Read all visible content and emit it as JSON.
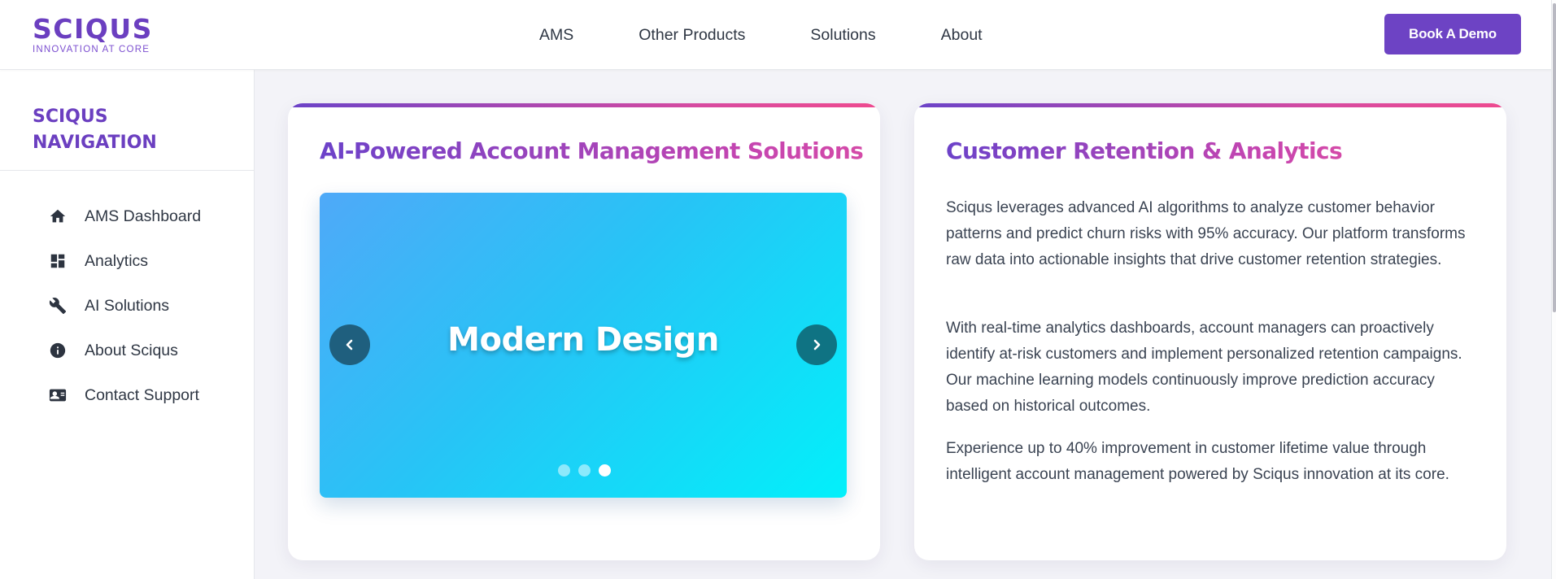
{
  "header": {
    "logo_title": "SCIQUS",
    "logo_tagline": "INNOVATION AT CORE",
    "nav": [
      "AMS",
      "Other Products",
      "Solutions",
      "About"
    ],
    "cta_label": "Book A Demo"
  },
  "sidebar": {
    "title_line1": "SCIQUS",
    "title_line2": "NAVIGATION",
    "items": [
      {
        "label": "AMS Dashboard",
        "icon": "home-icon"
      },
      {
        "label": "Analytics",
        "icon": "dashboard-icon"
      },
      {
        "label": "AI Solutions",
        "icon": "wrench-icon"
      },
      {
        "label": "About Sciqus",
        "icon": "info-icon"
      },
      {
        "label": "Contact Support",
        "icon": "contact-card-icon"
      }
    ]
  },
  "left_card": {
    "title": "AI-Powered Account Management Solutions",
    "carousel": {
      "slide_title": "Modern Design",
      "slide_count": 3,
      "active_slide": 3
    }
  },
  "right_card": {
    "title": "Customer Retention & Analytics",
    "paragraphs": [
      "Sciqus leverages advanced AI algorithms to analyze customer behavior patterns and predict churn risks with 95% accuracy. Our platform transforms raw data into actionable insights that drive customer retention strategies.",
      "With real-time analytics dashboards, account managers can proactively identify at-risk customers and implement personalized retention campaigns. Our machine learning models continuously improve prediction accuracy based on historical outcomes.",
      "Experience up to 40% improvement in customer lifetime value through intelligent account management powered by Sciqus innovation at its core."
    ]
  },
  "colors": {
    "brand": "#6b3fc0",
    "cta": "#6d43c4",
    "title_gradient_end": "#d44aa8"
  }
}
